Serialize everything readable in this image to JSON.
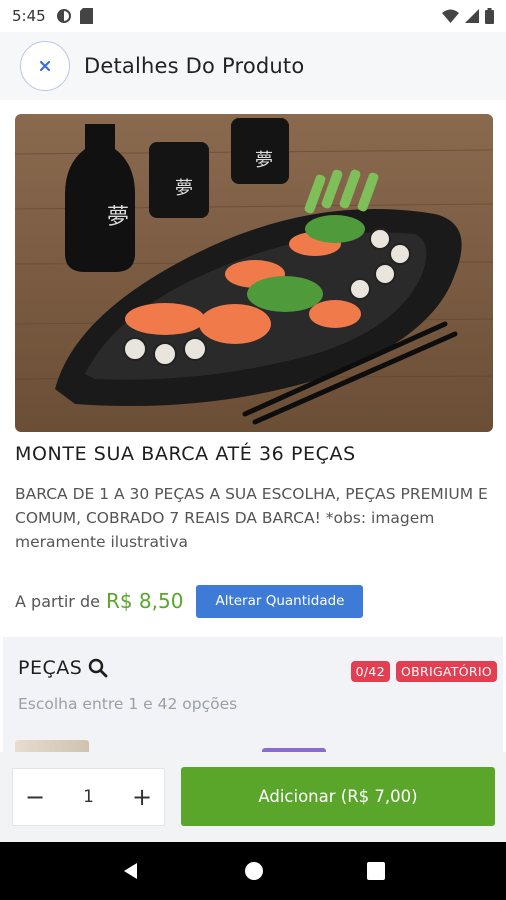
{
  "status_bar": {
    "time": "5:45",
    "left_icons": [
      "sync-icon",
      "sim-card-icon"
    ],
    "right_icons": [
      "wifi-icon",
      "signal-icon",
      "battery-icon"
    ]
  },
  "header": {
    "close_icon": "close-icon",
    "title": "Detalhes Do Produto"
  },
  "product": {
    "image": "sushi-barca-photo",
    "name": "MONTE SUA BARCA ATÉ 36 PEÇAS",
    "description": "BARCA DE 1 A 30 PEÇAS A SUA ESCOLHA, PEÇAS PREMIUM E COMUM, COBRADO 7 REAIS DA BARCA! *obs: imagem meramente ilustrativa",
    "price_label": "A partir de",
    "price": "R$ 8,50",
    "change_qty_label": "Alterar Quantidade"
  },
  "section": {
    "title": "PEÇAS",
    "search_icon": "search-icon",
    "count_badge": "0/42",
    "required_badge": "OBRIGATÓRIO",
    "subtitle": "Escolha entre 1 e 42 opções"
  },
  "action_bar": {
    "minus": "−",
    "quantity": "1",
    "plus": "+",
    "add_label": "Adicionar (R$ 7,00)"
  },
  "nav_bar": {
    "icons": [
      "back-icon",
      "home-icon",
      "recents-icon"
    ]
  },
  "colors": {
    "accent_blue": "#3e7bd6",
    "price_green": "#5aa62a",
    "badge_red": "#e23f53"
  }
}
